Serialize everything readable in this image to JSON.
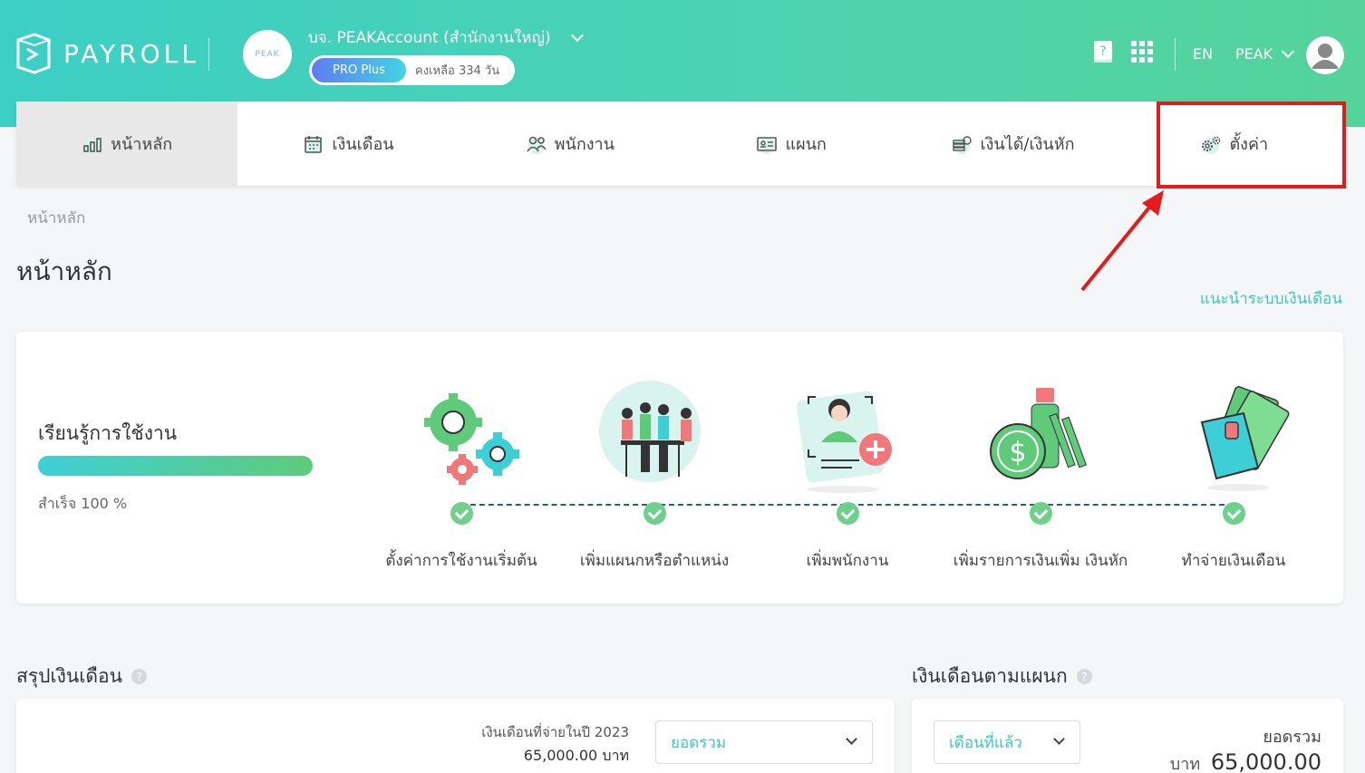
{
  "app": {
    "logo_text": "PAYROLL"
  },
  "company": {
    "logo_text": "PEAK",
    "name": "บจ. PEAKAccount (สำนักงานใหญ่)",
    "plan": "PRO Plus",
    "remaining": "คงเหลือ 334 วัน"
  },
  "header": {
    "icons": [
      "help-book-icon",
      "apps-grid-icon"
    ],
    "language": "EN",
    "user": "PEAK"
  },
  "nav": {
    "tabs": [
      {
        "label": "หน้าหลัก",
        "icon": "chart-bar-icon",
        "active": true
      },
      {
        "label": "เงินเดือน",
        "icon": "calendar-icon",
        "active": false
      },
      {
        "label": "พนักงาน",
        "icon": "people-icon",
        "active": false
      },
      {
        "label": "แผนก",
        "icon": "id-card-icon",
        "active": false
      },
      {
        "label": "เงินได้/เงินหัก",
        "icon": "money-stack-icon",
        "active": false
      },
      {
        "label": "ตั้งค่า",
        "icon": "gears-icon",
        "active": false
      }
    ]
  },
  "annotation": {
    "color": "#e51b1b",
    "target": "ตั้งค่า"
  },
  "breadcrumb": "หน้าหลัก",
  "page": {
    "title": "หน้าหลัก",
    "guide_link": "แนะนำระบบเงินเดือน"
  },
  "learning": {
    "title": "เรียนรู้การใช้งาน",
    "progress_text": "สำเร็จ 100 %",
    "progress": 1.0,
    "steps": [
      {
        "label": "ตั้งค่าการใช้งานเริ่มต้น",
        "done": true
      },
      {
        "label": "เพิ่มแผนกหรือตำแหน่ง",
        "done": true
      },
      {
        "label": "เพิ่มพนักงาน",
        "done": true
      },
      {
        "label": "เพิ่มรายการเงินเพิ่ม เงินหัก",
        "done": true
      },
      {
        "label": "ทำจ่ายเงินเดือน",
        "done": true
      }
    ]
  },
  "summary": {
    "title": "สรุปเงินเดือน",
    "caption": "เงินเดือนที่จ่ายในปี 2023",
    "value": "65,000.00 บาท",
    "sub": "",
    "select_value": "ยอดรวม"
  },
  "dept": {
    "title": "เงินเดือนตามแผนก",
    "select_value": "เดือนที่แล้ว",
    "total_label": "ยอดรวม",
    "total_unit": "บาท",
    "total_value": "65,000.00"
  },
  "colors": {
    "primary": "#3cc8c0",
    "header_start": "#3ccfc5",
    "header_end": "#54d39a",
    "check": "#6fd08c"
  }
}
